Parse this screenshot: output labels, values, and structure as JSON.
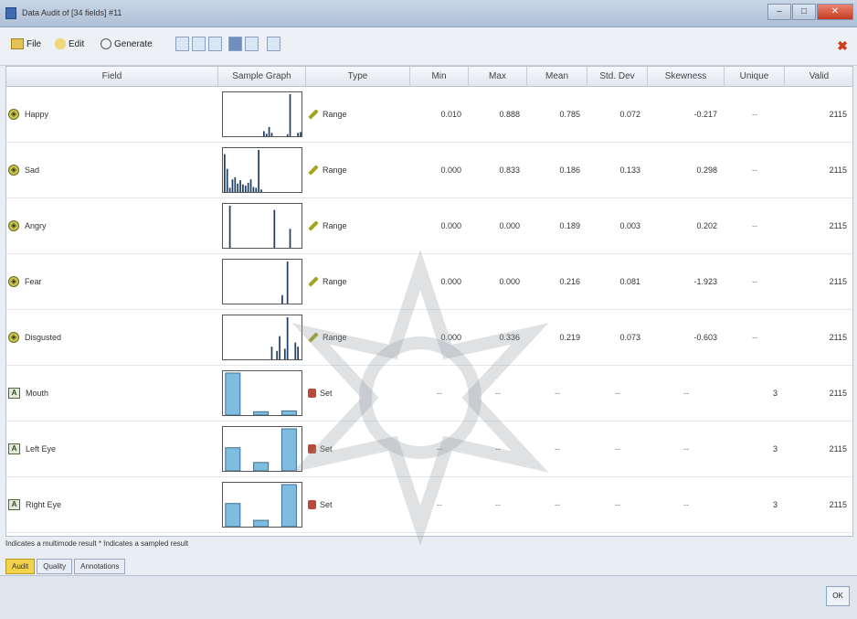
{
  "window": {
    "title": "Data Audit of [34 fields] #11"
  },
  "menu": {
    "file": "File",
    "edit": "Edit",
    "generate": "Generate"
  },
  "columns": [
    "Field",
    "Sample Graph",
    "Type",
    "Min",
    "Max",
    "Mean",
    "Std. Dev",
    "Skewness",
    "Unique",
    "Valid"
  ],
  "rows": [
    {
      "field": "Happy",
      "ftype": "range",
      "type": "Range",
      "min": "0.010",
      "max": "0.888",
      "mean": "0.785",
      "std": "0.072",
      "skew": "-0.217",
      "unique": "--",
      "valid": "2115",
      "bars": [
        0,
        0,
        0,
        0,
        0,
        0,
        0,
        0,
        0,
        0,
        0,
        0,
        0,
        0,
        0,
        0.12,
        0.06,
        0.22,
        0.08,
        0,
        0,
        0,
        0,
        0,
        0.05,
        1.0,
        0,
        0,
        0.08,
        0.1
      ]
    },
    {
      "field": "Sad",
      "ftype": "range",
      "type": "Range",
      "min": "0.000",
      "max": "0.833",
      "mean": "0.186",
      "std": "0.133",
      "skew": "0.298",
      "unique": "--",
      "valid": "2115",
      "bars": [
        0.9,
        0.55,
        0.1,
        0.3,
        0.35,
        0.2,
        0.28,
        0.18,
        0.15,
        0.22,
        0.3,
        0.12,
        0.1,
        1.0,
        0.06,
        0,
        0,
        0,
        0,
        0,
        0,
        0,
        0,
        0,
        0,
        0,
        0,
        0,
        0,
        0
      ]
    },
    {
      "field": "Angry",
      "ftype": "range",
      "type": "Range",
      "min": "0.000",
      "max": "0.000",
      "mean": "0.189",
      "std": "0.003",
      "skew": "0.202",
      "unique": "--",
      "valid": "2115",
      "bars": [
        0,
        0,
        1.0,
        0,
        0,
        0,
        0,
        0,
        0,
        0,
        0,
        0,
        0,
        0,
        0,
        0,
        0,
        0,
        0,
        0.9,
        0,
        0,
        0,
        0,
        0,
        0.45,
        0,
        0,
        0,
        0
      ]
    },
    {
      "field": "Fear",
      "ftype": "range",
      "type": "Range",
      "min": "0.000",
      "max": "0.000",
      "mean": "0.216",
      "std": "0.081",
      "skew": "-1.923",
      "unique": "--",
      "valid": "2115",
      "bars": [
        0,
        0,
        0,
        0,
        0,
        0,
        0,
        0,
        0,
        0,
        0,
        0,
        0,
        0,
        0,
        0,
        0,
        0,
        0,
        0,
        0,
        0,
        0.2,
        0,
        1.0,
        0,
        0,
        0,
        0,
        0
      ]
    },
    {
      "field": "Disgusted",
      "ftype": "range",
      "type": "Range",
      "min": "0.000",
      "max": "0.336",
      "mean": "0.219",
      "std": "0.073",
      "skew": "-0.603",
      "unique": "--",
      "valid": "2115",
      "bars": [
        0,
        0,
        0,
        0,
        0,
        0,
        0,
        0,
        0,
        0,
        0,
        0,
        0,
        0,
        0,
        0,
        0,
        0,
        0.3,
        0,
        0.2,
        0.55,
        0,
        0.25,
        1.0,
        0,
        0,
        0.4,
        0.3,
        0
      ]
    }
  ],
  "set_rows": [
    {
      "field": "Mouth",
      "ftype": "set",
      "type": "Set",
      "dash": "--",
      "unique": "3",
      "valid": "2115",
      "bars": [
        1.0,
        0.08,
        0.1
      ]
    },
    {
      "field": "Left Eye",
      "ftype": "set",
      "type": "Set",
      "dash": "--",
      "unique": "3",
      "valid": "2115",
      "bars": [
        0.55,
        0.2,
        1.0
      ]
    },
    {
      "field": "Right Eye",
      "ftype": "set",
      "type": "Set",
      "dash": "--",
      "unique": "3",
      "valid": "2115",
      "bars": [
        0.55,
        0.15,
        1.0
      ]
    }
  ],
  "status": "Indicates a multimode result   * Indicates a sampled result",
  "tabs": [
    "Audit",
    "Quality",
    "Annotations"
  ],
  "ok_label": "OK",
  "colors": {
    "accent": "#f3d34b",
    "bar_numeric": "#1f3f63",
    "bar_set": "#7ebde0"
  }
}
